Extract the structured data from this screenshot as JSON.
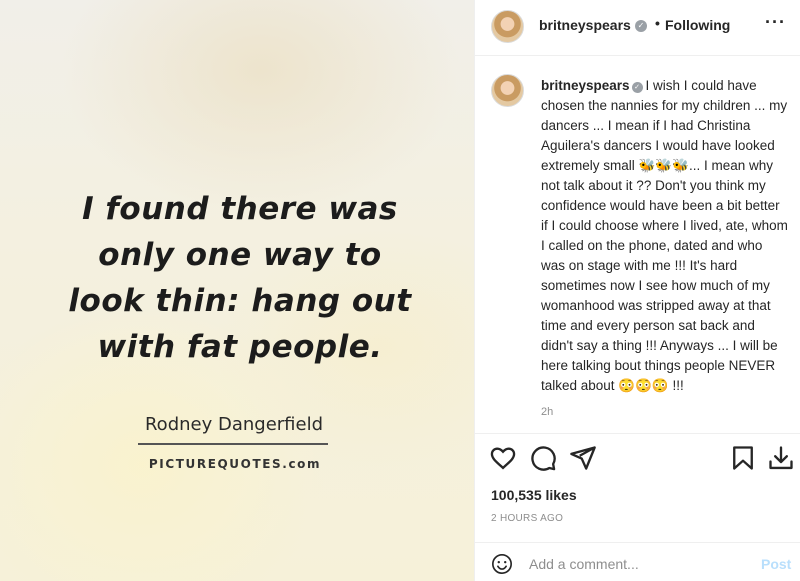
{
  "media": {
    "quote_lines": [
      "I found there was",
      "only one way to",
      "look thin: hang out",
      "with fat people."
    ],
    "author": "Rodney Dangerfield",
    "brand": "PICTUREQUOTES.com"
  },
  "header": {
    "username": "britneyspears",
    "verified_icon": "verified-badge-icon",
    "separator": "•",
    "follow_status": "Following",
    "more_icon": "more-options-icon",
    "more_label": "···"
  },
  "caption": {
    "username": "britneyspears",
    "text": "I wish I could have chosen the nannies for my children ... my dancers ... I mean if I had Christina Aguilera's dancers I would have looked extremely small 🐝🐝🐝... I mean why not talk about it ?? Don't you think my confidence would have been a bit better if I could choose where I lived, ate, whom I called on the phone, dated and who was on stage with me !!! It's hard sometimes now I see how much of my womanhood was stripped away at that time and every person sat back and didn't say a thing !!! Anyways ... I will be here talking bout things people NEVER talked about 😳😳😳 !!!",
    "time_ago": "2h"
  },
  "actions": {
    "like_icon": "heart-icon",
    "comment_icon": "comment-icon",
    "share_icon": "share-icon",
    "save_icon": "bookmark-icon",
    "download_icon": "download-icon"
  },
  "stats": {
    "likes": "100,535 likes",
    "posted": "2 HOURS AGO"
  },
  "comment": {
    "emoji_icon": "emoji-icon",
    "placeholder": "Add a comment...",
    "post_label": "Post"
  }
}
